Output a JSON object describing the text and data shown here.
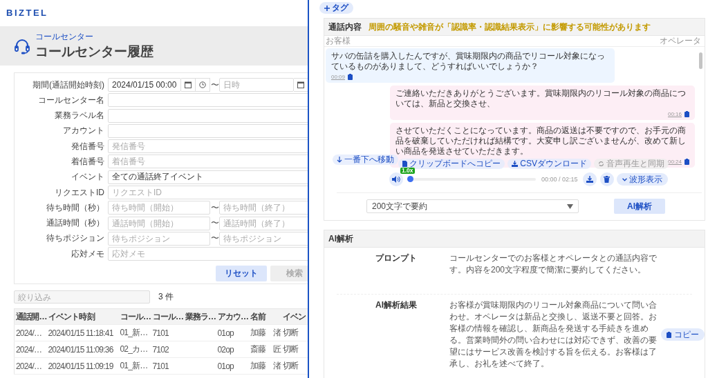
{
  "logo": "BIZTEL",
  "header": {
    "breadcrumb": "コールセンター",
    "title": "コールセンター履歴"
  },
  "search_form": {
    "fields": [
      {
        "label": "期間(通話開始時刻)",
        "kind": "datetime",
        "from": {
          "value": "2024/01/15 00:00"
        },
        "separator": "〜",
        "to": {
          "placeholder": "日時"
        }
      },
      {
        "label": "コールセンター名",
        "kind": "text"
      },
      {
        "label": "業務ラベル名",
        "kind": "text"
      },
      {
        "label": "アカウント",
        "kind": "text"
      },
      {
        "label": "発信番号",
        "kind": "text",
        "placeholder": "発信番号"
      },
      {
        "label": "着信番号",
        "kind": "text",
        "placeholder": "着信番号"
      },
      {
        "label": "イベント",
        "kind": "text",
        "value": "全ての通話終了イベント"
      },
      {
        "label": "リクエストID",
        "kind": "text",
        "placeholder": "リクエストID"
      },
      {
        "label": "待ち時間（秒）",
        "kind": "range",
        "from": {
          "placeholder": "待ち時間（開始）"
        },
        "separator": "〜",
        "to": {
          "placeholder": "待ち時間（終了）"
        }
      },
      {
        "label": "通話時間（秒）",
        "kind": "range",
        "from": {
          "placeholder": "通話時間（開始）"
        },
        "separator": "〜",
        "to": {
          "placeholder": "通話時間（終了）"
        }
      },
      {
        "label": "待ちポジション",
        "kind": "range",
        "from": {
          "placeholder": "待ちポジション"
        },
        "separator": "〜",
        "to": {
          "placeholder": "待ちポジション"
        }
      },
      {
        "label": "応対メモ",
        "kind": "text",
        "placeholder": "応対メモ"
      }
    ],
    "buttons": [
      {
        "label": "リセット",
        "disabled": false
      },
      {
        "label": "検索",
        "disabled": true
      }
    ]
  },
  "filter": {
    "placeholder": "絞り込み"
  },
  "result_count": "3 件",
  "table": {
    "columns": [
      "通話開…",
      "イベント時刻",
      "コール…",
      "コール…",
      "業務ラ…",
      "アカウ…",
      "名前",
      "イベン"
    ],
    "rows": [
      [
        "2024/…",
        "2024/01/15 11:18:41",
        "01_新…",
        "7101",
        "",
        "01op",
        "加藤　渚",
        "切断"
      ],
      [
        "2024/…",
        "2024/01/15 11:09:36",
        "02_カ…",
        "7102",
        "",
        "02op",
        "斎藤　匠",
        "切断"
      ],
      [
        "2024/…",
        "2024/01/15 11:09:19",
        "01_新…",
        "7101",
        "",
        "01op",
        "加藤　渚",
        "切断"
      ]
    ]
  },
  "tag_button": "タグ",
  "transcript": {
    "title": "通話内容",
    "notice": "周囲の騒音や雑音が「認識率・認識結果表示」に影響する可能性があります",
    "speakers": {
      "left": "お客様",
      "right": "オペレータ"
    },
    "messages": [
      {
        "kind": "customer",
        "text": "サバの缶詰を購入したんですが、賞味期限内の商品でリコール対象になっているものがありまして、どうすればいいでしょうか？",
        "time": "00:09"
      },
      {
        "kind": "operator",
        "text": "ご連絡いただきありがとうございます。賞味期限内のリコール対象の商品については、新品と交換させ、",
        "time": "00:16"
      },
      {
        "kind": "operator",
        "text": "させていただくことになっています。商品の返送は不要ですので、お手元の商品を破棄していただければ結構です。大変申し訳ございませんが、改めて新しい商品を発送させていただきます。",
        "time": "00:24"
      }
    ],
    "scroll_button": "一番下へ移動",
    "actions": [
      {
        "label": "クリップボードへコピー",
        "disabled": false
      },
      {
        "label": "CSVダウンロード",
        "disabled": false
      },
      {
        "label": "音声再生と同期",
        "disabled": true
      }
    ],
    "player": {
      "speed": "1.0x",
      "level": 0,
      "time": "00:00 / 02:15",
      "waveform_button": "波形表示"
    },
    "summary_select": "200文字で要約",
    "analyze_button": "AI解析"
  },
  "ai_analysis": {
    "title": "AI解析",
    "rows": [
      {
        "label": "プロンプト",
        "text": "コールセンターでのお客様とオペレータとの通話内容です。内容を200文字程度で簡潔に要約してください。"
      },
      {
        "label": "AI解析結果",
        "text": "お客様が賞味期限内のリコール対象商品について問い合わせ。オペレータは新品と交換し、返送不要と回答。お客様の情報を確認し、新商品を発送する手続きを進める。営業時間外の問い合わせには対応できず、改善の要望にはサービス改善を検討する旨を伝える。お客様は了承し、お礼を述べて終了。",
        "copy_button": "コピー"
      }
    ]
  }
}
